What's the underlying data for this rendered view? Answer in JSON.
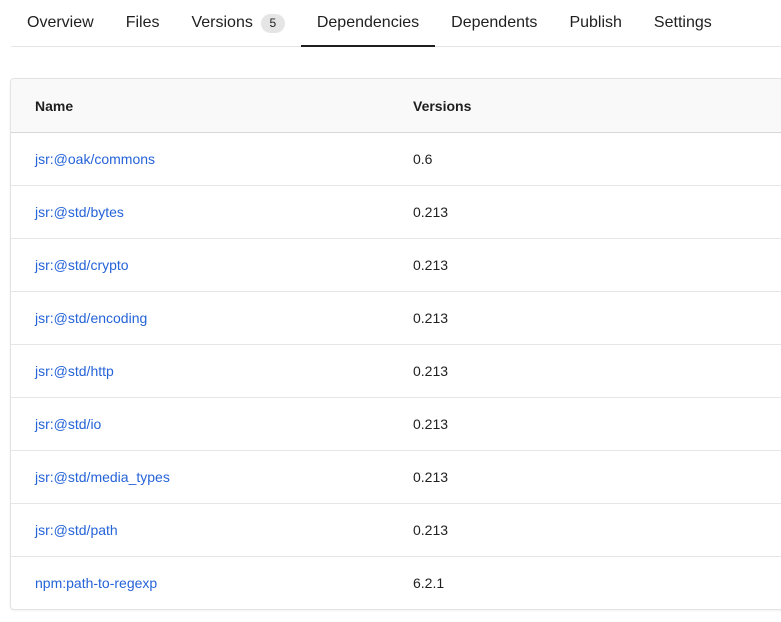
{
  "tabs": [
    {
      "label": "Overview",
      "active": false
    },
    {
      "label": "Files",
      "active": false
    },
    {
      "label": "Versions",
      "badge": "5",
      "active": false
    },
    {
      "label": "Dependencies",
      "active": true
    },
    {
      "label": "Dependents",
      "active": false
    },
    {
      "label": "Publish",
      "active": false
    },
    {
      "label": "Settings",
      "active": false
    }
  ],
  "table": {
    "headers": {
      "name": "Name",
      "versions": "Versions"
    },
    "rows": [
      {
        "name": "jsr:@oak/commons",
        "version": "0.6"
      },
      {
        "name": "jsr:@std/bytes",
        "version": "0.213"
      },
      {
        "name": "jsr:@std/crypto",
        "version": "0.213"
      },
      {
        "name": "jsr:@std/encoding",
        "version": "0.213"
      },
      {
        "name": "jsr:@std/http",
        "version": "0.213"
      },
      {
        "name": "jsr:@std/io",
        "version": "0.213"
      },
      {
        "name": "jsr:@std/media_types",
        "version": "0.213"
      },
      {
        "name": "jsr:@std/path",
        "version": "0.213"
      },
      {
        "name": "npm:path-to-regexp",
        "version": "6.2.1"
      }
    ]
  },
  "colors": {
    "link": "#2563d8",
    "active_tab_underline": "#1f1f1f"
  }
}
